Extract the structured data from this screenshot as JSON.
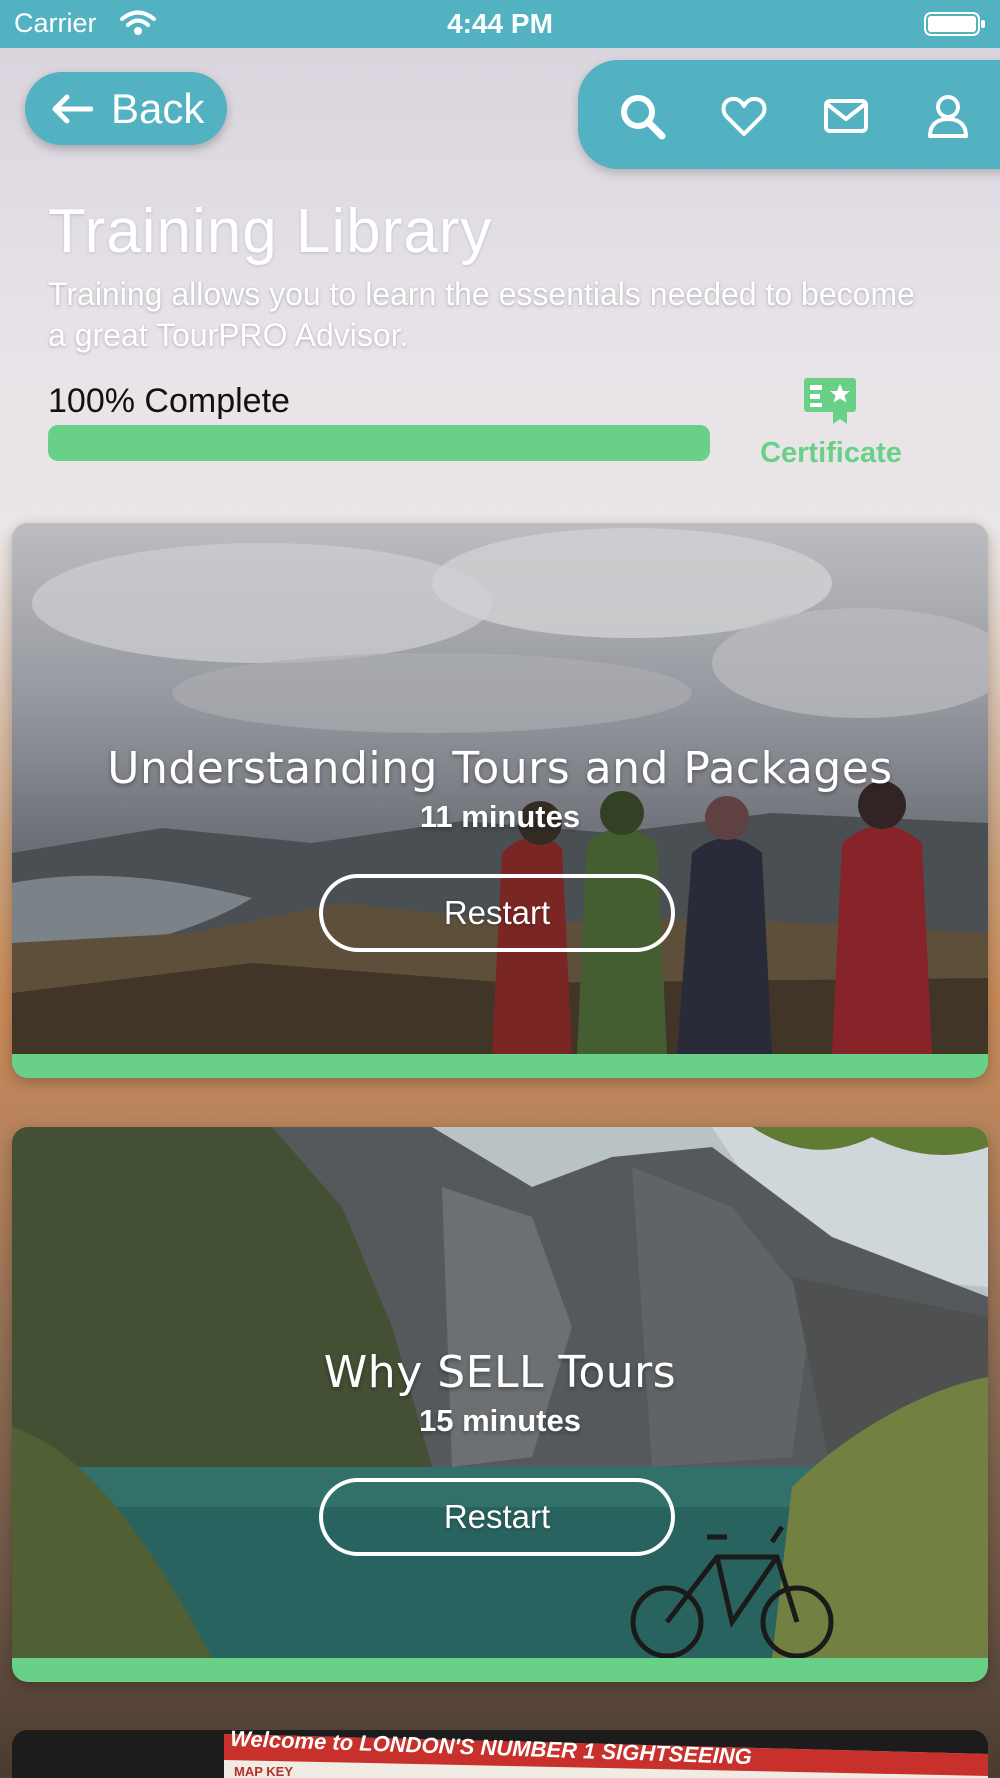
{
  "status_bar": {
    "carrier": "Carrier",
    "time": "4:44 PM"
  },
  "header": {
    "back_label": "Back",
    "nav_icons": [
      "search-icon",
      "heart-icon",
      "mail-icon",
      "user-icon"
    ]
  },
  "library": {
    "title": "Training Library",
    "subtitle": "Training allows you to learn the essentials needed to become a great TourPRO Advisor.",
    "progress_text": "100% Complete",
    "progress_percent": 100,
    "certificate_label": "Certificate"
  },
  "courses": [
    {
      "title": "Understanding Tours and Packages",
      "duration": "11 minutes",
      "button_label": "Restart"
    },
    {
      "title": "Why SELL Tours",
      "duration": "15 minutes",
      "button_label": "Restart"
    }
  ],
  "partial_card": {
    "banner_text": "Welcome to LONDON'S NUMBER 1 SIGHTSEEING",
    "map_key": "MAP KEY"
  },
  "colors": {
    "brand_teal": "#52b2c1",
    "progress_green": "#68d187"
  }
}
